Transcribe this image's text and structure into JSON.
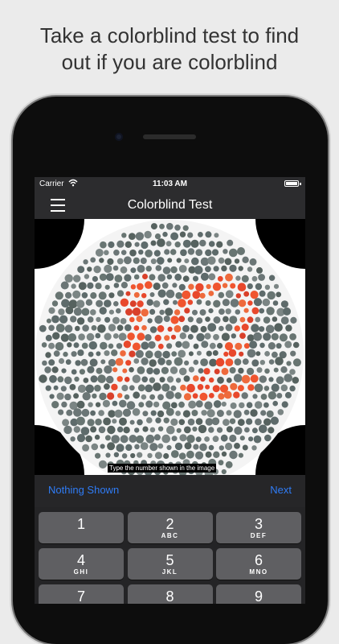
{
  "promo": {
    "headline_line1": "Take a colorblind test to find",
    "headline_line2": "out if you are colorblind"
  },
  "status_bar": {
    "carrier": "Carrier",
    "time": "11:03 AM",
    "wifi_icon": "wifi-icon",
    "battery_icon": "battery-icon"
  },
  "nav": {
    "title": "Colorblind Test",
    "menu_icon": "hamburger-menu-icon"
  },
  "test_plate": {
    "depicted_number": "12",
    "figure_color": "#e8482c",
    "background_dot_color": "#5e6b6b",
    "caption": "Type the number shown in the image"
  },
  "toolbar": {
    "nothing_shown_label": "Nothing Shown",
    "next_label": "Next",
    "accent_color": "#2f7cf6"
  },
  "keypad": {
    "rows": [
      [
        {
          "num": "1",
          "letters": ""
        },
        {
          "num": "2",
          "letters": "ABC"
        },
        {
          "num": "3",
          "letters": "DEF"
        }
      ],
      [
        {
          "num": "4",
          "letters": "GHI"
        },
        {
          "num": "5",
          "letters": "JKL"
        },
        {
          "num": "6",
          "letters": "MNO"
        }
      ],
      [
        {
          "num": "7",
          "letters": ""
        },
        {
          "num": "8",
          "letters": ""
        },
        {
          "num": "9",
          "letters": ""
        }
      ]
    ]
  }
}
